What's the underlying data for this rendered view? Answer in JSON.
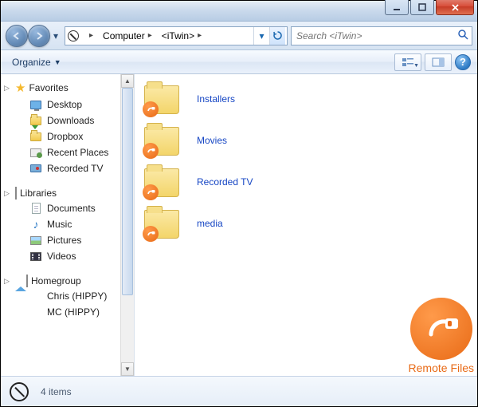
{
  "breadcrumb": {
    "root": "Computer",
    "current": "<iTwin>"
  },
  "search": {
    "placeholder": "Search <iTwin>"
  },
  "toolbar": {
    "organize": "Organize"
  },
  "sidebar": {
    "favorites": {
      "label": "Favorites",
      "items": [
        "Desktop",
        "Downloads",
        "Dropbox",
        "Recent Places",
        "Recorded TV"
      ]
    },
    "libraries": {
      "label": "Libraries",
      "items": [
        "Documents",
        "Music",
        "Pictures",
        "Videos"
      ]
    },
    "homegroup": {
      "label": "Homegroup",
      "items": [
        "Chris (HIPPY)",
        "MC (HIPPY)"
      ]
    }
  },
  "folders": [
    {
      "name": "Installers"
    },
    {
      "name": "Movies"
    },
    {
      "name": "Recorded TV"
    },
    {
      "name": "media"
    }
  ],
  "badge": {
    "label": "Remote Files"
  },
  "status": {
    "text": "4 items"
  }
}
